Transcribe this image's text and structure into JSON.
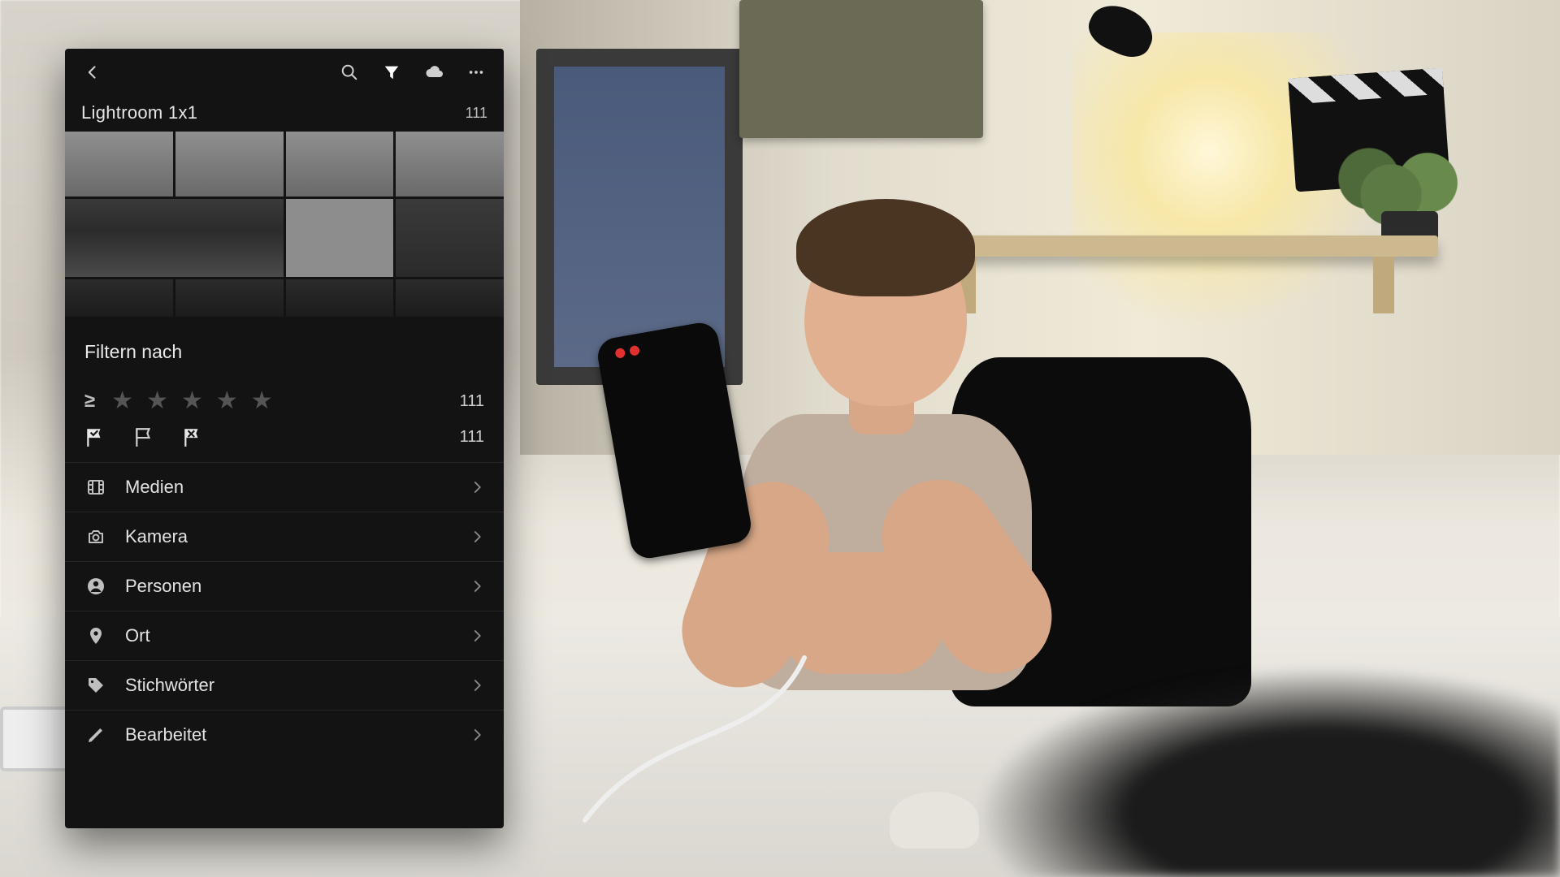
{
  "album": {
    "title": "Lightroom 1x1",
    "count": "111"
  },
  "filter": {
    "heading": "Filtern nach",
    "rating_operator": "≥",
    "rating_count": "111",
    "flag_count": "111",
    "categories": [
      {
        "icon": "film",
        "label": "Medien"
      },
      {
        "icon": "camera",
        "label": "Kamera"
      },
      {
        "icon": "person",
        "label": "Personen"
      },
      {
        "icon": "pin",
        "label": "Ort"
      },
      {
        "icon": "tag",
        "label": "Stichwörter"
      },
      {
        "icon": "pencil",
        "label": "Bearbeitet"
      }
    ]
  }
}
